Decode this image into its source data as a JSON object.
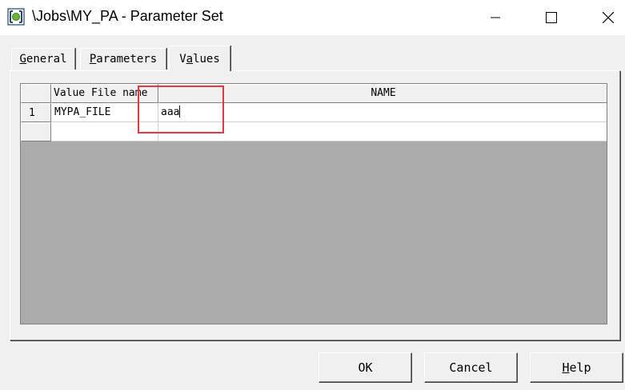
{
  "window": {
    "title": "\\Jobs\\MY_PA - Parameter Set"
  },
  "tabs": [
    {
      "label_pre": "",
      "label_accel": "G",
      "label_post": "eneral"
    },
    {
      "label_pre": "",
      "label_accel": "P",
      "label_post": "arameters"
    },
    {
      "label_pre": "V",
      "label_accel": "a",
      "label_post": "lues"
    }
  ],
  "grid": {
    "columns": [
      "Value File name",
      "NAME"
    ],
    "rows": [
      {
        "header": "1",
        "cells": [
          "MYPA_FILE",
          "aaa"
        ]
      },
      {
        "header": "",
        "cells": [
          "",
          ""
        ]
      }
    ]
  },
  "buttons": {
    "ok": "OK",
    "cancel": "Cancel",
    "help_accel": "H",
    "help_post": "elp"
  },
  "colors": {
    "highlight": "#e0393e",
    "grid_background": "#ababab",
    "app_icon_green": "#6db33f"
  }
}
